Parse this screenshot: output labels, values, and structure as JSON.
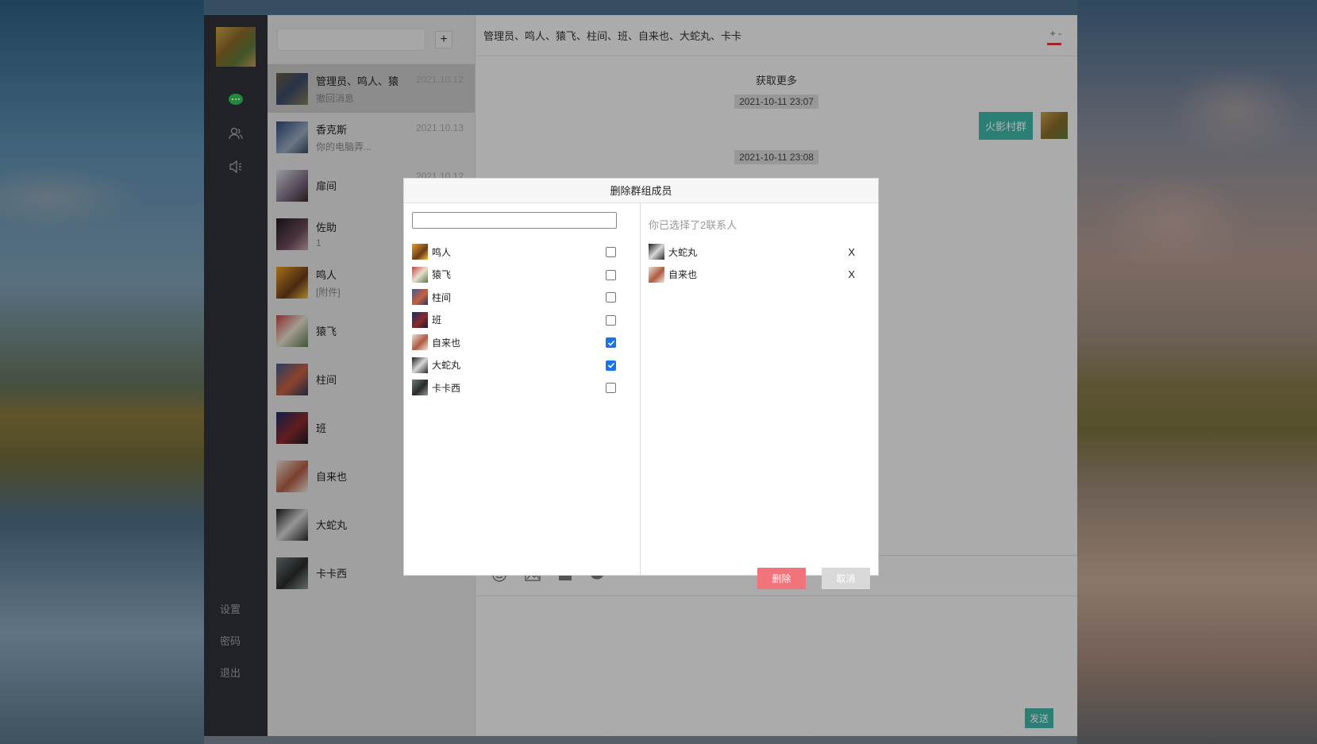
{
  "colors": {
    "nav_bg": "#2e3238",
    "accent": "#3fb6a8",
    "danger": "#f0747a",
    "checkbox": "#1a73e8"
  },
  "nav": {
    "icons": [
      "chat-icon",
      "contacts-icon",
      "speaker-icon"
    ],
    "settings": "设置",
    "password": "密码",
    "logout": "退出"
  },
  "list": {
    "add": "+",
    "conversations": [
      {
        "name": "管理员、鸣人、猿",
        "last": "撤回消息",
        "time": "2021.10.12"
      },
      {
        "name": "香克斯",
        "last": "你的电脑弄...",
        "time": "2021.10.13"
      },
      {
        "name": "扉间",
        "last": "",
        "time": "2021.10.12"
      },
      {
        "name": "佐助",
        "last": "1",
        "time": ""
      },
      {
        "name": "鸣人",
        "last": "[附件]",
        "time": ""
      },
      {
        "name": "猿飞",
        "last": "",
        "time": ""
      },
      {
        "name": "柱间",
        "last": "",
        "time": ""
      },
      {
        "name": "班",
        "last": "",
        "time": ""
      },
      {
        "name": "自来也",
        "last": "",
        "time": ""
      },
      {
        "name": "大蛇丸",
        "last": "",
        "time": ""
      },
      {
        "name": "卡卡西",
        "last": "",
        "time": ""
      }
    ]
  },
  "chat": {
    "title": "管理员、鸣人、猿飞、柱间、班、自来也、大蛇丸、卡卡",
    "more": "+ -",
    "load_more": "获取更多",
    "ts1": "2021-10-11 23:07",
    "msg1": "火影村群",
    "ts2": "2021-10-11 23:08",
    "send": "发送"
  },
  "modal": {
    "title": "删除群组成员",
    "search_placeholder": "",
    "members": [
      {
        "name": "鸣人",
        "checked": false
      },
      {
        "name": "猿飞",
        "checked": false
      },
      {
        "name": "柱间",
        "checked": false
      },
      {
        "name": "班",
        "checked": false
      },
      {
        "name": "自来也",
        "checked": true
      },
      {
        "name": "大蛇丸",
        "checked": true
      },
      {
        "name": "卡卡西",
        "checked": false
      }
    ],
    "selected_info": "你已选择了2联系人",
    "selected": [
      {
        "name": "大蛇丸",
        "remove": "X"
      },
      {
        "name": "自来也",
        "remove": "X"
      }
    ],
    "delete_label": "删除",
    "cancel_label": "取消"
  }
}
